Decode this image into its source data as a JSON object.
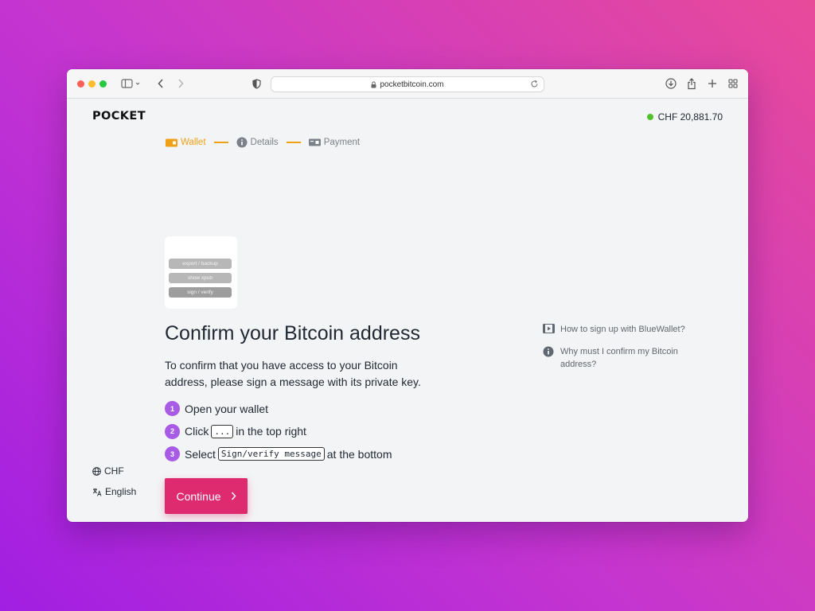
{
  "browser": {
    "url": "pocketbitcoin.com"
  },
  "header": {
    "logo": "POCKET",
    "balance": "CHF 20,881.70",
    "balance_status_color": "#53c12a"
  },
  "steps": [
    {
      "label": "Wallet",
      "icon": "wallet-icon",
      "active": true
    },
    {
      "label": "Details",
      "icon": "info-icon",
      "active": false
    },
    {
      "label": "Payment",
      "icon": "payment-icon",
      "active": false
    }
  ],
  "wallet_preview": {
    "options": [
      "export / backup",
      "show xpub",
      "sign / verify"
    ]
  },
  "main": {
    "title": "Confirm your Bitcoin address",
    "description": "To confirm that you have access to your Bitcoin address, please sign a message with its private key.",
    "instructions": [
      {
        "number": "1",
        "text": "Open your wallet"
      },
      {
        "number": "2",
        "before": "Click",
        "key": "...",
        "after": "in the top right"
      },
      {
        "number": "3",
        "before": "Select",
        "key": "Sign/verify message",
        "after": "at the bottom"
      }
    ],
    "continue_label": "Continue"
  },
  "help": {
    "video_link": "How to sign up with BlueWallet?",
    "info_link": "Why must I confirm my Bitcoin address?"
  },
  "footer": {
    "currency": "CHF",
    "language": "English"
  },
  "colors": {
    "accent": "#de2a6f",
    "step_active": "#f0a017",
    "step_number": "#a85ce6"
  }
}
